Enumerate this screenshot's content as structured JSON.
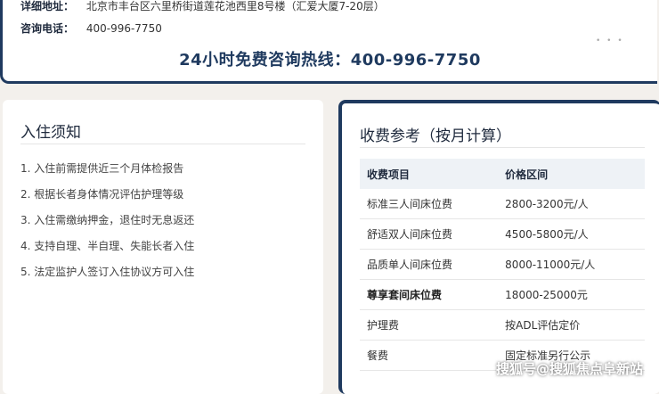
{
  "contact": {
    "address_label": "详细地址：",
    "address_value": "北京市丰台区六里桥街道莲花池西里8号楼（汇爱大厦7-20层）",
    "phone_label": "咨询电话：",
    "phone_value": "400-996-7750",
    "hotline_label": "24小时免费咨询热线：",
    "hotline_number": "400-996-7750"
  },
  "notice": {
    "title": "入住须知",
    "items": [
      "1. 入住前需提供近三个月体检报告",
      "2. 根据长者身体情况评估护理等级",
      "3. 入住需缴纳押金，退住时无息返还",
      "4. 支持自理、半自理、失能长者入住",
      "5. 法定监护人签订入住协议方可入住"
    ]
  },
  "fees": {
    "title": "收费参考（按月计算）",
    "headers": [
      "收费项目",
      "价格区间"
    ],
    "rows": [
      [
        "标准三人间床位费",
        "2800-3200元/人"
      ],
      [
        "舒适双人间床位费",
        "4500-5800元/人"
      ],
      [
        "品质单人间床位费",
        "8000-11000元/人"
      ],
      [
        "尊享套间床位费",
        "18000-25000元"
      ],
      [
        "护理费",
        "按ADL评估定价"
      ],
      [
        "餐费",
        "固定标准另行公示"
      ]
    ]
  },
  "watermark": "搜狐号@搜狐焦点阜新站",
  "colors": {
    "accent": "#1f3a5f",
    "background": "#f3f0ec"
  }
}
